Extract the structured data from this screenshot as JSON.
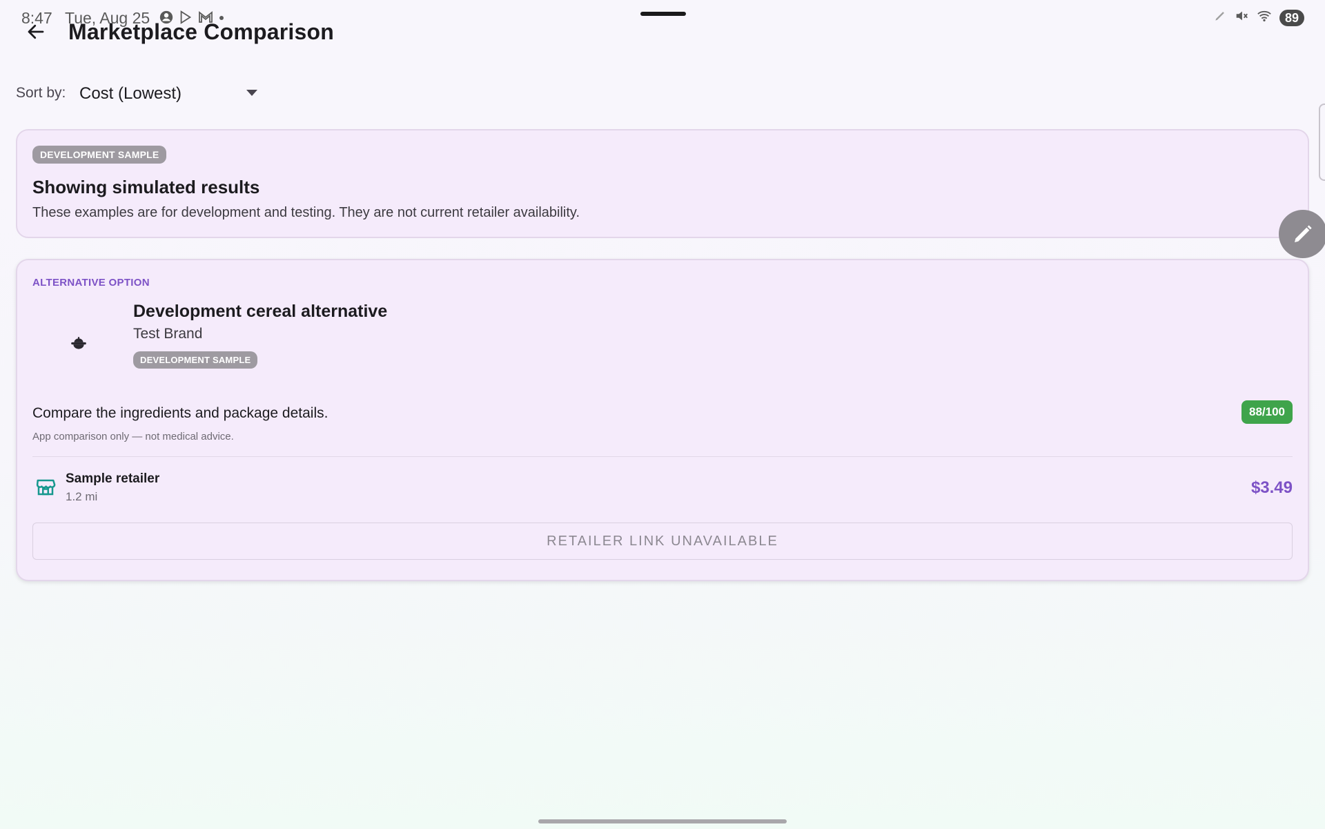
{
  "status_bar": {
    "time": "8:47",
    "date": "Tue, Aug 25",
    "battery": "89",
    "icons": [
      "account-circle-icon",
      "play-store-icon",
      "gmail-icon",
      "dot-icon",
      "pen-icon",
      "mute-icon",
      "wifi-icon"
    ]
  },
  "app_bar": {
    "title": "Marketplace Comparison",
    "back_icon": "arrow-back-icon"
  },
  "sort": {
    "label": "Sort by:",
    "selected": "Cost (Lowest)"
  },
  "notice": {
    "chip": "DEVELOPMENT SAMPLE",
    "title": "Showing simulated results",
    "body": "These examples are for development and testing. They are not current retailer availability."
  },
  "product_card": {
    "section_label": "ALTERNATIVE OPTION",
    "name": "Development cereal alternative",
    "brand": "Test Brand",
    "chip": "DEVELOPMENT SAMPLE",
    "compare_text": "Compare the ingredients and package details.",
    "score": "88/100",
    "disclaimer": "App comparison only — not medical advice.",
    "retailer": {
      "name": "Sample retailer",
      "distance": "1.2 mi",
      "price": "$3.49"
    },
    "button_label": "RETAILER LINK UNAVAILABLE"
  },
  "colors": {
    "accent": "#7d52c6",
    "score_green": "#3fa44b",
    "card_bg": "#f5ebfb",
    "store_icon": "#17988e"
  }
}
